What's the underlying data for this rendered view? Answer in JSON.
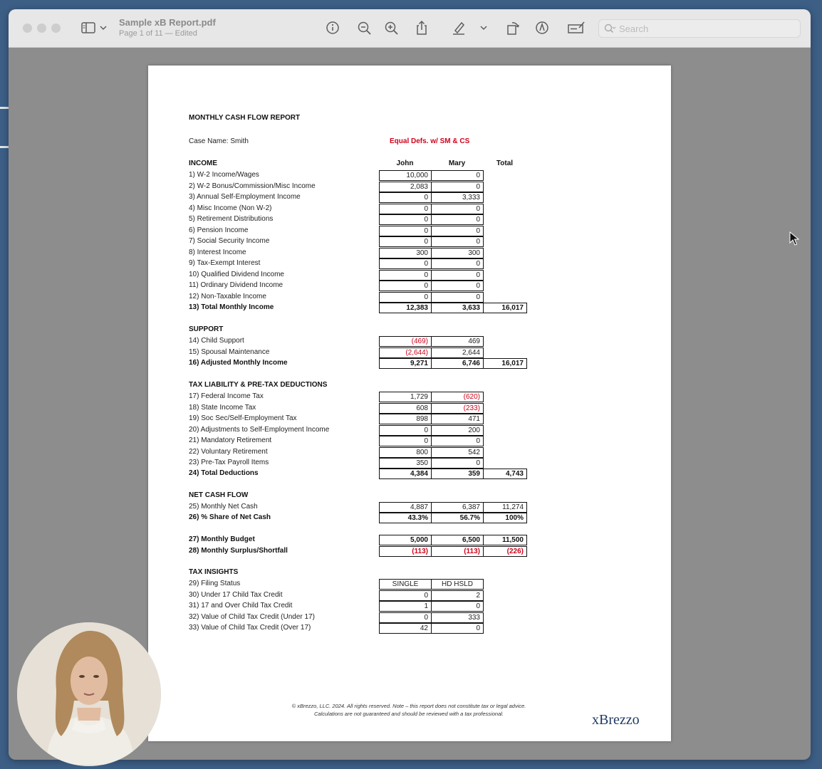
{
  "window": {
    "title": "Sample xB Report.pdf",
    "subtitle": "Page 1 of 11 — Edited",
    "search_placeholder": "Search",
    "toolbar_icons": [
      "sidebar-icon",
      "chevron-down-icon",
      "info-icon",
      "zoom-out-icon",
      "zoom-in-icon",
      "share-icon",
      "highlight-icon",
      "chevron-down-icon",
      "rotate-icon",
      "markup-icon",
      "form-icon",
      "search-icon"
    ]
  },
  "report": {
    "title": "MONTHLY CASH FLOW REPORT",
    "case_name": "Case Name: Smith",
    "scenario": "Equal Defs. w/ SM & CS",
    "columns": [
      "John",
      "Mary",
      "Total"
    ],
    "income": {
      "heading": "INCOME",
      "rows": [
        {
          "label": "1) W-2 Income/Wages",
          "john": "10,000",
          "mary": "0"
        },
        {
          "label": "2) W-2 Bonus/Commission/Misc Income",
          "john": "2,083",
          "mary": "0"
        },
        {
          "label": "3) Annual Self-Employment Income",
          "john": "0",
          "mary": "3,333"
        },
        {
          "label": "4) Misc Income (Non W-2)",
          "john": "0",
          "mary": "0"
        },
        {
          "label": "5) Retirement Distributions",
          "john": "0",
          "mary": "0"
        },
        {
          "label": "6) Pension Income",
          "john": "0",
          "mary": "0"
        },
        {
          "label": "7) Social Security Income",
          "john": "0",
          "mary": "0"
        },
        {
          "label": "8) Interest Income",
          "john": "300",
          "mary": "300"
        },
        {
          "label": "9) Tax-Exempt Interest",
          "john": "0",
          "mary": "0"
        },
        {
          "label": "10) Qualified Dividend Income",
          "john": "0",
          "mary": "0"
        },
        {
          "label": "11) Ordinary Dividend Income",
          "john": "0",
          "mary": "0"
        },
        {
          "label": "12) Non-Taxable Income",
          "john": "0",
          "mary": "0"
        }
      ],
      "total": {
        "label": "13) Total Monthly Income",
        "john": "12,383",
        "mary": "3,633",
        "total": "16,017"
      }
    },
    "support": {
      "heading": "SUPPORT",
      "rows": [
        {
          "label": "14) Child Support",
          "john": "(469)",
          "mary": "469"
        },
        {
          "label": "15) Spousal Maintenance",
          "john": "(2,644)",
          "mary": "2,644"
        }
      ],
      "total": {
        "label": "16) Adjusted Monthly Income",
        "john": "9,271",
        "mary": "6,746",
        "total": "16,017"
      }
    },
    "tax": {
      "heading": "TAX LIABILITY & PRE-TAX DEDUCTIONS",
      "rows": [
        {
          "label": "17) Federal Income Tax",
          "john": "1,729",
          "mary": "(620)"
        },
        {
          "label": "18) State Income Tax",
          "john": "608",
          "mary": "(233)"
        },
        {
          "label": "19) Soc Sec/Self-Employment Tax",
          "john": "898",
          "mary": "471"
        },
        {
          "label": "20) Adjustments to Self-Employment Income",
          "john": "0",
          "mary": "200"
        },
        {
          "label": "21) Mandatory Retirement",
          "john": "0",
          "mary": "0"
        },
        {
          "label": "22) Voluntary Retirement",
          "john": "800",
          "mary": "542"
        },
        {
          "label": "23) Pre-Tax Payroll Items",
          "john": "350",
          "mary": "0"
        }
      ],
      "total": {
        "label": "24) Total Deductions",
        "john": "4,384",
        "mary": "359",
        "total": "4,743"
      }
    },
    "net": {
      "heading": "NET CASH FLOW",
      "rows": [
        {
          "label": "25) Monthly Net Cash",
          "john": "4,887",
          "mary": "6,387",
          "total": "11,274"
        },
        {
          "label": "26) % Share of Net Cash",
          "john": "43.3%",
          "mary": "56.7%",
          "total": "100%"
        }
      ],
      "budget": [
        {
          "label": "27) Monthly Budget",
          "john": "5,000",
          "mary": "6,500",
          "total": "11,500"
        },
        {
          "label": "28) Monthly Surplus/Shortfall",
          "john": "(113)",
          "mary": "(113)",
          "total": "(226)"
        }
      ]
    },
    "insights": {
      "heading": "TAX INSIGHTS",
      "rows": [
        {
          "label": "29) Filing Status",
          "john": "SINGLE",
          "mary": "HD HSLD"
        },
        {
          "label": "30) Under 17 Child Tax Credit",
          "john": "0",
          "mary": "2"
        },
        {
          "label": "31) 17 and Over Child Tax Credit",
          "john": "1",
          "mary": "0"
        },
        {
          "label": "32) Value of Child Tax Credit (Under 17)",
          "john": "0",
          "mary": "333"
        },
        {
          "label": "33) Value of Child Tax Credit (Over 17)",
          "john": "42",
          "mary": "0"
        }
      ]
    },
    "footer_line1": "© xBrezzo, LLC. 2024. All rights reserved. Note – this report does not constitute tax or legal advice.",
    "footer_line2": "Calculations are not guaranteed and should be reviewed with a tax professional.",
    "logo": "xBrezzo"
  },
  "colors": {
    "negative": "#d0021b",
    "desktop": "#3d5f86",
    "logo": "#1f3a64"
  }
}
